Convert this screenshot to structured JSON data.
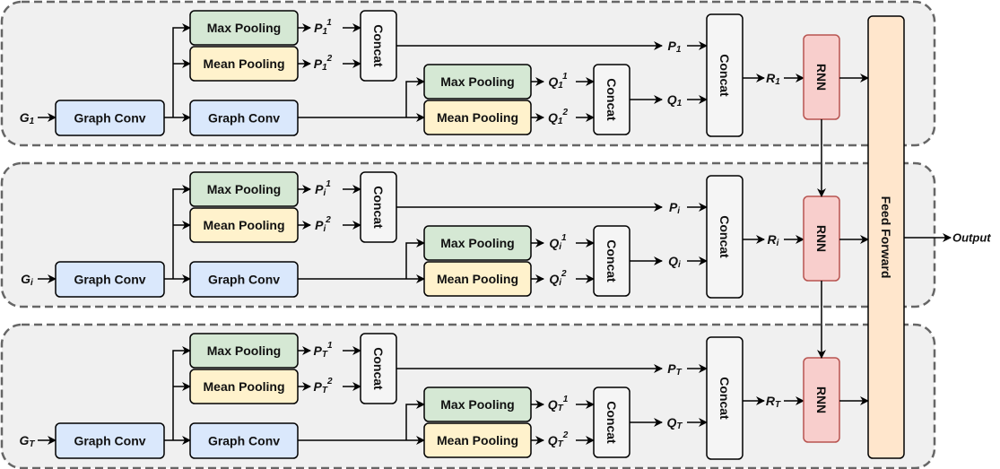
{
  "labels": {
    "graph_conv": "Graph Conv",
    "max_pooling": "Max Pooling",
    "mean_pooling": "Mean Pooling",
    "concat": "Concat",
    "rnn": "RNN",
    "feed_forward": "Feed Forward",
    "output": "Output"
  },
  "rows": [
    {
      "input": "G",
      "p": "P",
      "q": "Q",
      "r": "R",
      "subscript": "1",
      "sup1": "1",
      "sup2": "2"
    },
    {
      "input": "G",
      "p": "P",
      "q": "Q",
      "r": "R",
      "subscript": "i",
      "sup1": "1",
      "sup2": "2"
    },
    {
      "input": "G",
      "p": "P",
      "q": "Q",
      "r": "R",
      "subscript": "T",
      "sup1": "1",
      "sup2": "2"
    }
  ],
  "colors": {
    "panel_fill": "#f0f0f0",
    "panel_stroke": "#666666",
    "graph_conv": "#dae8fc",
    "max_pooling": "#d5e8d4",
    "mean_pooling": "#fff2cc",
    "concat": "#f5f5f5",
    "rnn_fill": "#f8cecc",
    "rnn_stroke": "#b85450",
    "feed_forward": "#ffe6cc"
  }
}
